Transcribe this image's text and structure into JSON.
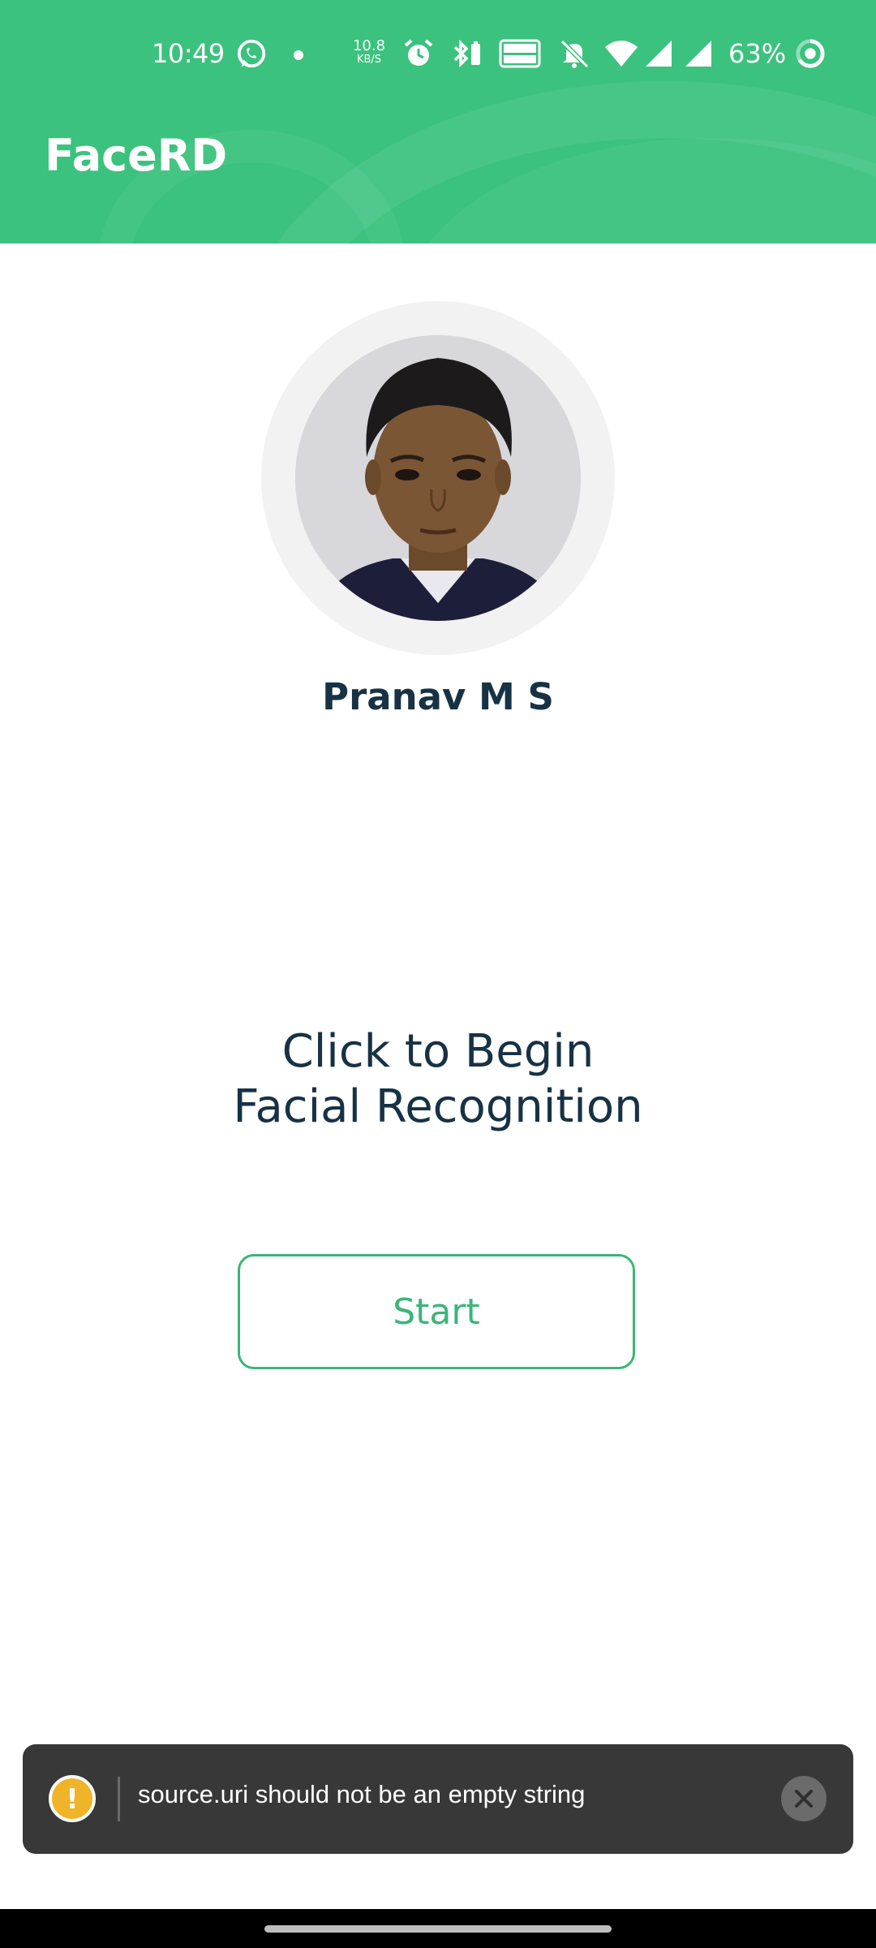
{
  "status_bar": {
    "time": "10:49",
    "net_speed_value": "10.8",
    "net_speed_unit": "KB/S",
    "battery_percent": "63%",
    "icons": [
      "whatsapp-icon",
      "dot-icon",
      "alarm-icon",
      "bluetooth-icon",
      "volte-icon",
      "bell-muted-icon",
      "wifi-icon",
      "signal-icon",
      "signal-icon",
      "battery-ring-icon"
    ]
  },
  "header": {
    "title": "FaceRD",
    "background_color": "#3bc27e"
  },
  "profile": {
    "name": "Pranav M S"
  },
  "prompt": {
    "line1": "Click to Begin",
    "line2": "Facial Recognition"
  },
  "actions": {
    "start_label": "Start",
    "accent_color": "#3bb57a"
  },
  "toast": {
    "icon": "warning-icon",
    "message": "source.uri should not be an empty string",
    "close_icon": "close-icon"
  }
}
